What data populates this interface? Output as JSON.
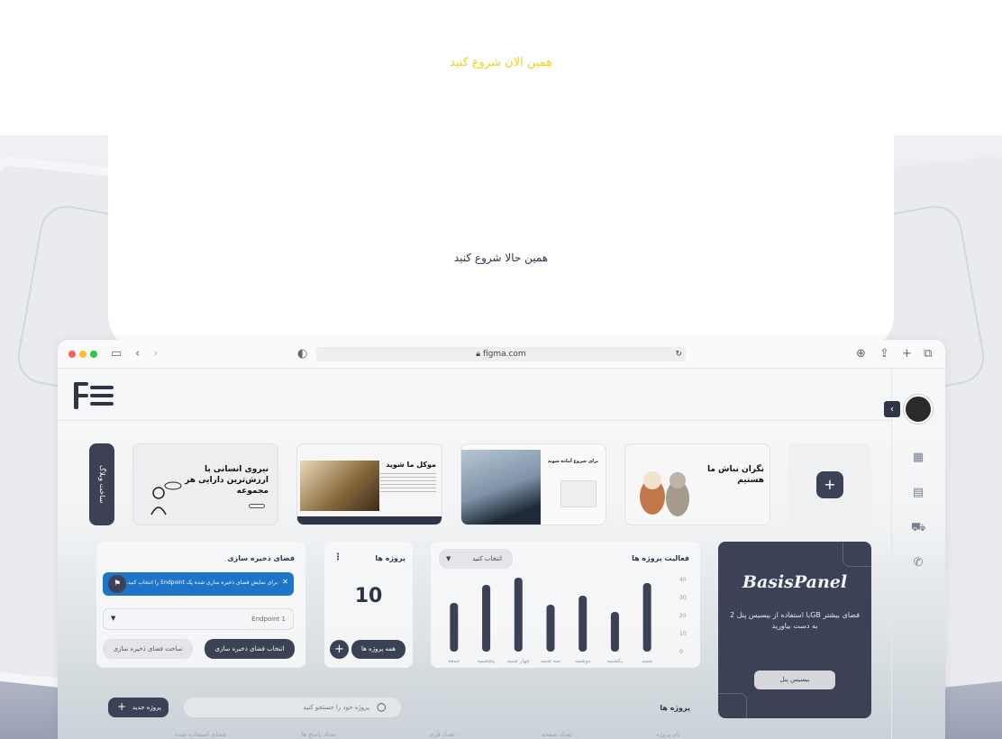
{
  "page": {
    "tagline_top": "همین الان شروع کنید",
    "tagline_mid": "همین حالا شروع کنید"
  },
  "browser": {
    "url": "figma.com",
    "colors": {
      "close": "#ff5f57",
      "minimize": "#febc2e",
      "maximize": "#28c840"
    }
  },
  "templates": {
    "new_template_label": "ساخت وبلاگ",
    "cards": [
      {
        "title": "نگران نباش ما هستیم",
        "theme": "pets"
      },
      {
        "title": "برای شروع آماده شوید",
        "theme": "building"
      },
      {
        "title": "موکل ما شوید",
        "theme": "law"
      },
      {
        "title": "نیروی انسانی با ارزش‌ترین دارایی هر مجموعه",
        "theme": "hr"
      }
    ]
  },
  "activity": {
    "title": "فعالیت پروژه ها",
    "select_placeholder": "انتخاب کنید"
  },
  "chart_data": {
    "type": "bar",
    "categories": [
      "شنبه",
      "یکشنبه",
      "دوشنبه",
      "سه شنبه",
      "چهار شنبه",
      "پنجشنبه",
      "جمعه"
    ],
    "values": [
      38,
      22,
      31,
      26,
      41,
      37,
      27
    ],
    "ylim": [
      0,
      40
    ],
    "yticks": [
      "40",
      "30",
      "20",
      "10",
      "0"
    ]
  },
  "projects_card": {
    "title": "پروژه ها",
    "count": "10",
    "all_projects_label": "همه پروژه ها"
  },
  "storage": {
    "title": "فضای ذخیره سازی",
    "notice": "برای نمایش فضای ذخیره سازی شده یک Endpoint را انتخاب کنید.",
    "endpoint_value": "Endpoint 1",
    "select_btn": "انتخاب فضای ذخیره سازی",
    "create_btn": "ساخت فضای ذخیره سازی"
  },
  "basis_panel": {
    "logo": "BasisPanel",
    "text": "با استفاده از بیسیس پنل 2GB فضای بیشتر به دست بیاورید",
    "button": "بیسیس پنل"
  },
  "projects_section": {
    "title": "پروژه ها",
    "search_placeholder": "پروژه خود را جستجو کنید",
    "new_project": "پروژه جدید",
    "columns": [
      "نام پروژه",
      "تعداد صفحه",
      "تعداد فرم",
      "تعداد پاسخ ها",
      "فضای استفاده شده"
    ]
  }
}
